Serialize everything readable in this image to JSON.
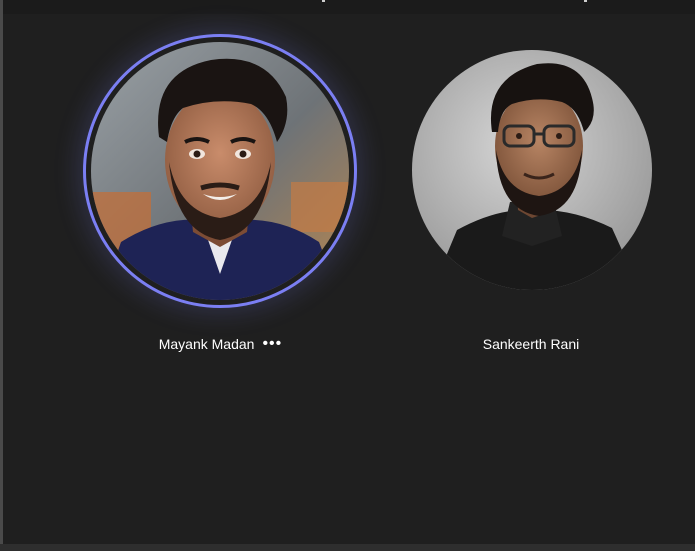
{
  "participants": [
    {
      "name": "Mayank Madan",
      "is_speaking": true,
      "ring_color": "#7b7ff3",
      "more_icon": "more-options-icon"
    },
    {
      "name": "Sankeerth Rani",
      "is_speaking": false
    }
  ],
  "colors": {
    "stage_background": "#1f1f1f",
    "speaking_ring": "#7b7ff3",
    "name_text": "#ffffff"
  }
}
